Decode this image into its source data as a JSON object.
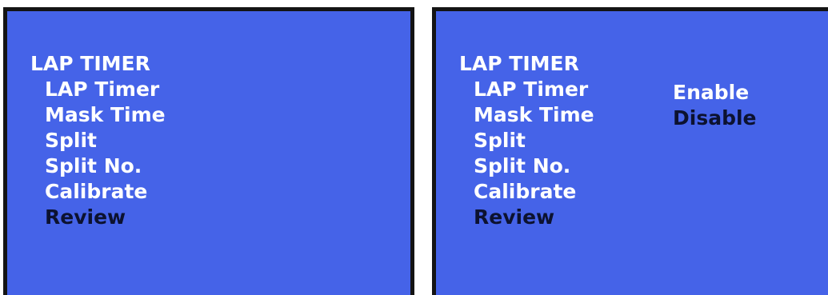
{
  "left_screen": {
    "title": "LAP TIMER",
    "items": [
      {
        "label": "LAP Timer",
        "selected": false
      },
      {
        "label": "Mask Time",
        "selected": false
      },
      {
        "label": "Split",
        "selected": false
      },
      {
        "label": "Split No.",
        "selected": false
      },
      {
        "label": "Calibrate",
        "selected": false
      },
      {
        "label": "Review",
        "selected": true
      }
    ]
  },
  "right_screen": {
    "title": "LAP TIMER",
    "items": [
      {
        "label": "LAP Timer",
        "selected": false
      },
      {
        "label": "Mask Time",
        "selected": false
      },
      {
        "label": "Split",
        "selected": false
      },
      {
        "label": "Split No.",
        "selected": false
      },
      {
        "label": "Calibrate",
        "selected": false
      },
      {
        "label": "Review",
        "selected": true
      }
    ],
    "options": [
      {
        "label": "Enable",
        "selected": false
      },
      {
        "label": "Disable",
        "selected": true
      }
    ]
  },
  "colors": {
    "screen_background": "#4563e8",
    "text": "#ffffff",
    "selected_text": "#0c1230",
    "border": "#141414"
  }
}
